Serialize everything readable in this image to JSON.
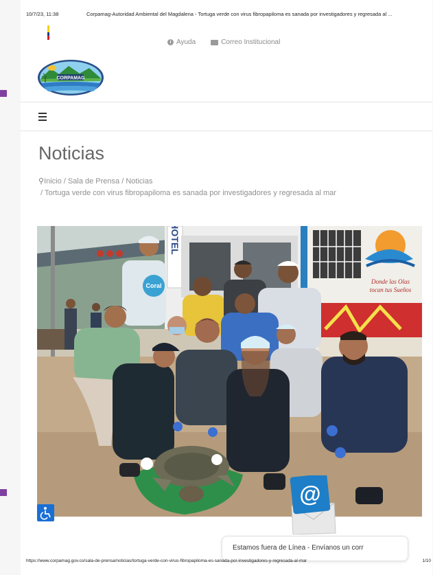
{
  "print": {
    "timestamp": "10/7/23, 11:38",
    "title": "Corpamag-Autoridad Ambiental del Magdalena - Tortuga verde con virus fibropapiloma es sanada por investigadores y regresada al ...",
    "url": "https://www.corpamag.gov.co/sala-de-prensa/noticias/tortuga-verde-con-virus-fibropapiloma-es-sanada-por-investigadores-y-regresada-al-mar",
    "page": "1/10"
  },
  "toplinks": {
    "help": "Ayuda",
    "mail": "Correo Institucional"
  },
  "logo": {
    "text": "CORPAMAG"
  },
  "page_title": "Noticias",
  "breadcrumb": {
    "home": "Inicio",
    "sep": "/",
    "press": "Sala de Prensa",
    "news": "Noticias",
    "current": "Tortuga verde con virus fibropapiloma es sanada por investigadores y regresada al mar"
  },
  "photo": {
    "hotel_sign": "HOTEL",
    "shirt_brand": "Coral",
    "mural_text_1": "Donde las Olas",
    "mural_text_2": "tocan tus Sueños"
  },
  "chat": {
    "text": "Estamos fuera de Línea - Envíanos un corr"
  },
  "colors": {
    "accessibility": "#1a6fd4",
    "mail_badge": "#1e7ec7",
    "side_mark": "#7f3fa0"
  },
  "icons": {
    "help": "info-icon",
    "mail": "envelope-icon",
    "menu": "hamburger-icon",
    "pin": "map-pin-icon",
    "accessibility": "wheelchair-icon",
    "chat": "at-sign-icon"
  }
}
